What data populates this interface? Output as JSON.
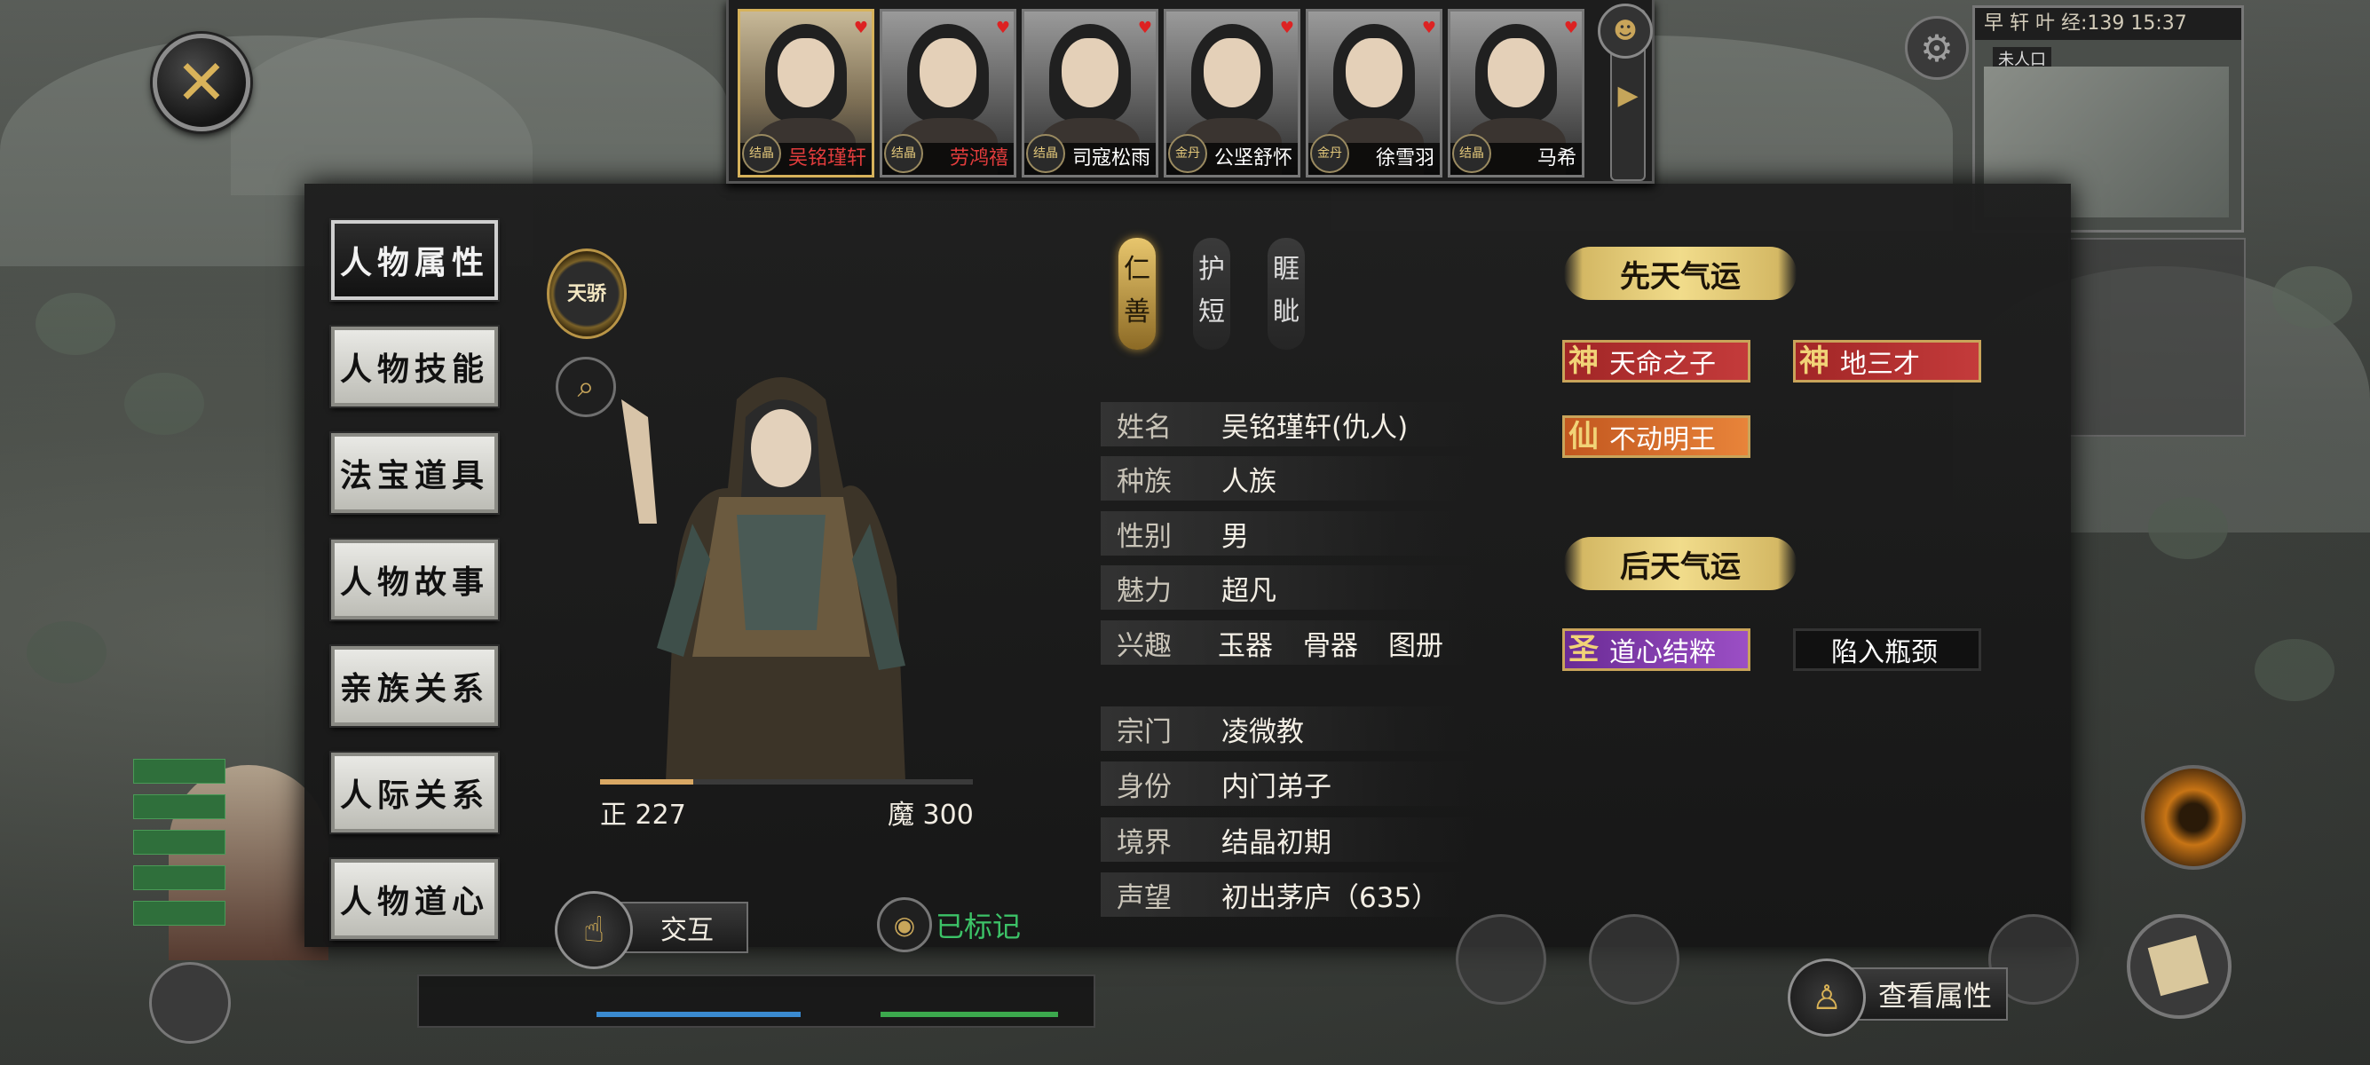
{
  "header": {
    "portraits": [
      {
        "rank": "结晶",
        "name": "吴铭瑾轩",
        "name_color": "#e13c3c",
        "active": true
      },
      {
        "rank": "结晶",
        "name": "劳鸿禧",
        "name_color": "#e13c3c",
        "active": false
      },
      {
        "rank": "结晶",
        "name": "司寇松雨",
        "name_color": "#ffffff",
        "active": false
      },
      {
        "rank": "金丹",
        "name": "公坚舒怀",
        "name_color": "#ffffff",
        "active": false
      },
      {
        "rank": "金丹",
        "name": "徐雪羽",
        "name_color": "#ffffff",
        "active": false
      },
      {
        "rank": "结晶",
        "name": "马希",
        "name_color": "#ffffff",
        "active": false
      }
    ],
    "minimap_title": "早 轩 叶 经:139 15:37",
    "minimap_sub": "未人口"
  },
  "menu": [
    {
      "label": "人物属性",
      "active": true
    },
    {
      "label": "人物技能",
      "active": false
    },
    {
      "label": "法宝道具",
      "active": false
    },
    {
      "label": "人物故事",
      "active": false
    },
    {
      "label": "亲族关系",
      "active": false
    },
    {
      "label": "人际关系",
      "active": false
    },
    {
      "label": "人物道心",
      "active": false
    }
  ],
  "badge": {
    "label": "天骄"
  },
  "morality": {
    "left_label": "正 227",
    "right_label": "魔 300",
    "fill_fraction": 0.25
  },
  "traits": [
    {
      "text": "仁善",
      "highlight": true
    },
    {
      "text": "护短",
      "highlight": false
    },
    {
      "text": "睚眦",
      "highlight": false
    }
  ],
  "info": {
    "name": {
      "k": "姓名",
      "v": "吴铭瑾轩(仇人)"
    },
    "race": {
      "k": "种族",
      "v": "人族"
    },
    "gender": {
      "k": "性别",
      "v": "男"
    },
    "charm": {
      "k": "魅力",
      "v": "超凡"
    },
    "hobby": {
      "k": "兴趣",
      "v1": "玉器",
      "v2": "骨器",
      "v3": "图册"
    },
    "sect": {
      "k": "宗门",
      "v": "凌微教"
    },
    "identity": {
      "k": "身份",
      "v": "内门弟子"
    },
    "realm": {
      "k": "境界",
      "v": "结晶初期"
    },
    "fame": {
      "k": "声望",
      "v": "初出茅庐（635）"
    }
  },
  "luck": {
    "innate_title": "先天气运",
    "innate": [
      {
        "glyph": "神",
        "label": "天命之子"
      },
      {
        "glyph": "神",
        "label": "地三才"
      },
      {
        "glyph": "仙",
        "label": "不动明王"
      }
    ],
    "acquired_title": "后天气运",
    "acquired": [
      {
        "glyph": "圣",
        "label": "道心结粹"
      },
      {
        "glyph": "",
        "label": "陷入瓶颈"
      }
    ]
  },
  "actions": {
    "interact": "交互",
    "marked": "已标记",
    "view_attr": "查看属性"
  },
  "colors": {
    "gold": "#d9b256",
    "marked_green": "#3cc267",
    "tag_red": "#c43b3b",
    "tag_orange": "#e8843a",
    "tag_purple": "#9b4fc5"
  }
}
